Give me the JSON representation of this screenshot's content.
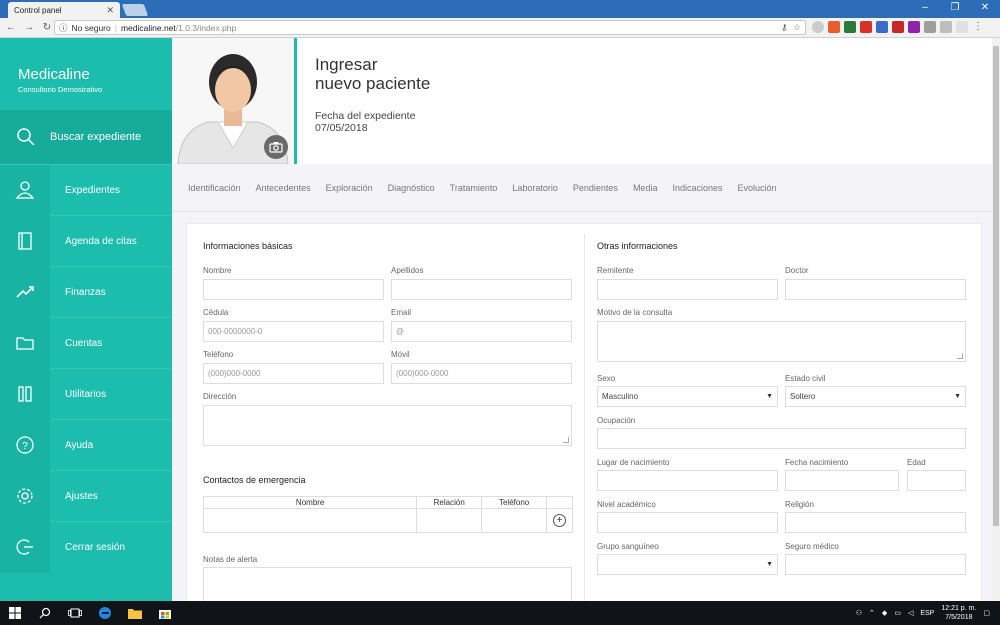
{
  "browser": {
    "tab_title": "Control panel",
    "insecure_label": "No seguro",
    "url_host": "medicaline.net",
    "url_path": "/1.0.3/index.php"
  },
  "sidebar": {
    "brand_name": "Medicaline",
    "brand_sub": "Consultorio Demostrativo",
    "search_label": "Buscar expediente",
    "items": [
      {
        "label": "Expedientes",
        "icon": "user-icon"
      },
      {
        "label": "Agenda de citas",
        "icon": "notebook-icon"
      },
      {
        "label": "Finanzas",
        "icon": "trend-icon"
      },
      {
        "label": "Cuentas",
        "icon": "folder-icon"
      },
      {
        "label": "Utilitarios",
        "icon": "tools-icon"
      },
      {
        "label": "Ayuda",
        "icon": "help-icon"
      },
      {
        "label": "Ajustes",
        "icon": "gear-icon"
      },
      {
        "label": "Cerrar sesión",
        "icon": "logout-icon"
      }
    ]
  },
  "header": {
    "title_line1": "Ingresar",
    "title_line2": "nuevo paciente",
    "date_label": "Fecha del expediente",
    "date_value": "07/05/2018"
  },
  "tabs": [
    "Identificación",
    "Antecedentes",
    "Exploración",
    "Diagnóstico",
    "Tratamiento",
    "Laboratorio",
    "Pendientes",
    "Media",
    "Indicaciones",
    "Evolución"
  ],
  "left": {
    "section_title": "Informaciones básicas",
    "nombre_label": "Nombre",
    "apellidos_label": "Apellidos",
    "cedula_label": "Cédula",
    "cedula_placeholder": "000-0000000-0",
    "email_label": "Email",
    "email_placeholder": "@",
    "telefono_label": "Teléfono",
    "telefono_placeholder": "(000)000-0000",
    "movil_label": "Móvil",
    "movil_placeholder": "(000)000-0000",
    "direccion_label": "Dirección",
    "emergency_title": "Contactos de emergencia",
    "emergency_cols": [
      "Nombre",
      "Relación",
      "Teléfono"
    ],
    "alert_label": "Notas de alerta"
  },
  "right": {
    "section_title": "Otras informaciones",
    "remitente_label": "Remitente",
    "doctor_label": "Doctor",
    "motivo_label": "Motivo de la consulta",
    "sexo_label": "Sexo",
    "sexo_value": "Masculino",
    "estado_label": "Estado civil",
    "estado_value": "Soltero",
    "ocupacion_label": "Ocupación",
    "lugar_label": "Lugar de nacimiento",
    "fecha_nac_label": "Fecha nacimiento",
    "edad_label": "Edad",
    "nivel_label": "Nivel académico",
    "religion_label": "Religión",
    "grupo_label": "Grupo sanguíneo",
    "seguro_label": "Seguro médico"
  },
  "taskbar": {
    "lang": "ESP",
    "time": "12:21 p. m.",
    "date": "7/5/2018"
  },
  "colors": {
    "accent": "#1cbdad",
    "accent_dark": "#17ab9c"
  }
}
